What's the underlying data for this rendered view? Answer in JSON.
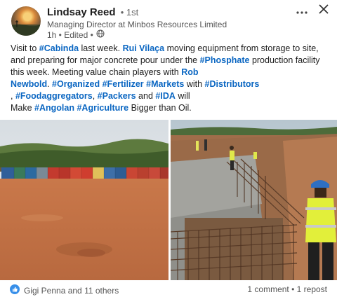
{
  "post": {
    "author_name": "Lindsay Reed",
    "degree": "• 1st",
    "headline": "Managing Director at Minbos Resources Limited",
    "meta": "1h • Edited •",
    "lines": [
      [
        {
          "t": "Visit to ",
          "tag": false
        },
        {
          "t": "#Cabinda",
          "tag": true
        },
        {
          "t": " last week. ",
          "tag": false
        },
        {
          "t": "Rui Vilaça",
          "tag": true
        },
        {
          "t": " moving equipment from storage to site,",
          "tag": false
        }
      ],
      [
        {
          "t": "and preparing for major concrete pour under the ",
          "tag": false
        },
        {
          "t": "#Phosphate",
          "tag": true
        },
        {
          "t": " production facility",
          "tag": false
        }
      ],
      [
        {
          "t": "this week. Meeting value chain players with ",
          "tag": false
        },
        {
          "t": "Rob",
          "tag": true
        }
      ],
      [
        {
          "t": "Newbold",
          "tag": true
        },
        {
          "t": ". ",
          "tag": false
        },
        {
          "t": "#Organized",
          "tag": true
        },
        {
          "t": " ",
          "tag": false
        },
        {
          "t": "#Fertilizer",
          "tag": true
        },
        {
          "t": " ",
          "tag": false
        },
        {
          "t": "#Markets",
          "tag": true
        },
        {
          "t": " with ",
          "tag": false
        },
        {
          "t": "#Distributors",
          "tag": true
        }
      ],
      [
        {
          "t": ", ",
          "tag": false
        },
        {
          "t": "#Foodaggregators",
          "tag": true
        },
        {
          "t": ", ",
          "tag": false
        },
        {
          "t": "#Packers",
          "tag": true
        },
        {
          "t": " and ",
          "tag": false
        },
        {
          "t": "#IDA",
          "tag": true
        },
        {
          "t": " will",
          "tag": false
        }
      ],
      [
        {
          "t": "Make ",
          "tag": false
        },
        {
          "t": "#Angolan",
          "tag": true
        },
        {
          "t": " ",
          "tag": false
        },
        {
          "t": "#Agriculture",
          "tag": true
        },
        {
          "t": " Bigger than Oil.",
          "tag": false
        }
      ]
    ]
  },
  "footer": {
    "reactions_text": "Gigi Penna and 11 others",
    "comments_text": "1 comment",
    "separator": " • ",
    "reposts_text": "1 repost"
  },
  "icons": {
    "more": "ellipsis-icon",
    "close": "close-icon",
    "visibility": "globe-icon",
    "reaction": "like-icon"
  },
  "colors": {
    "link": "#0a66c2",
    "text": "#1d1d1d",
    "muted": "#666666"
  }
}
